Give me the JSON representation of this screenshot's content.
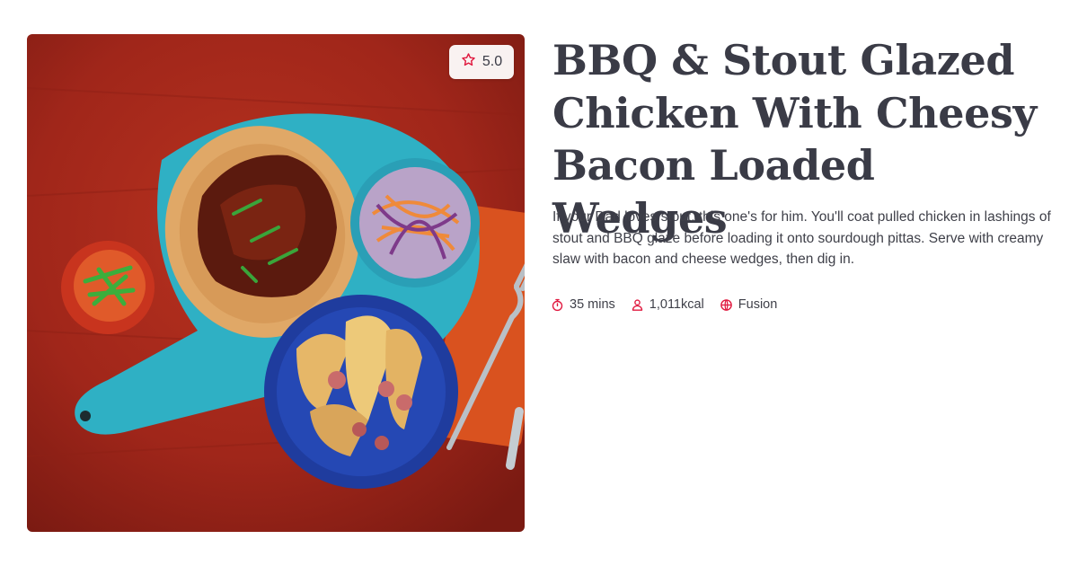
{
  "recipe": {
    "title": "BBQ & Stout Glazed Chicken With Cheesy Bacon Loaded Wedges",
    "description": "If your Dad loves stout, this one's for him. You'll coat pulled chicken in lashings of stout and BBQ glaze before loading it onto sourdough pittas. Serve with creamy slaw with bacon and cheese wedges, then dig in.",
    "rating": "5.0",
    "meta": {
      "time": "35 mins",
      "calories": "1,011kcal",
      "cuisine": "Fusion"
    }
  },
  "icons": {
    "rating": "star-outline-icon",
    "time": "stopwatch-icon",
    "calories": "person-icon",
    "cuisine": "globe-icon"
  },
  "colors": {
    "accent": "#e0193f",
    "title_text": "#3a3b46",
    "body_text": "#3f4049",
    "background": "#ffffff"
  }
}
